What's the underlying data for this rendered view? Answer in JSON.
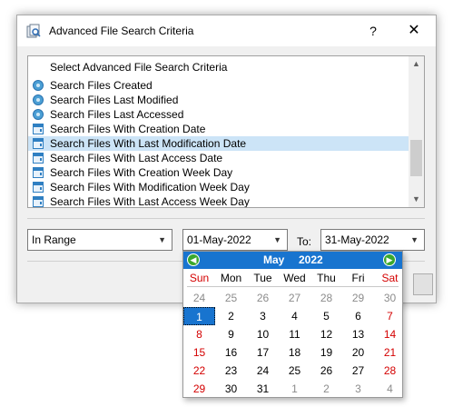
{
  "window": {
    "title": "Advanced File Search Criteria",
    "help_label": "?",
    "close_label": "✕"
  },
  "list": {
    "header": "Select Advanced File Search Criteria",
    "items": [
      {
        "label": "Search Files Created",
        "icon": "clock-icon"
      },
      {
        "label": "Search Files Last Modified",
        "icon": "clock-icon"
      },
      {
        "label": "Search Files Last Accessed",
        "icon": "clock-icon"
      },
      {
        "label": "Search Files With Creation Date",
        "icon": "calendar-icon"
      },
      {
        "label": "Search Files With Last Modification Date",
        "icon": "calendar-icon",
        "selected": true
      },
      {
        "label": "Search Files With Last Access Date",
        "icon": "calendar-icon"
      },
      {
        "label": "Search Files With Creation Week Day",
        "icon": "calendar-icon"
      },
      {
        "label": "Search Files With Modification Week Day",
        "icon": "calendar-icon"
      },
      {
        "label": "Search Files With Last Access Week Day",
        "icon": "calendar-icon"
      }
    ]
  },
  "criteria": {
    "mode": "In Range",
    "from_date": "01-May-2022",
    "to_label": "To:",
    "to_date": "31-May-2022"
  },
  "calendar": {
    "month": "May",
    "year": "2022",
    "prev_label": "◀",
    "next_label": "▶",
    "weekdays": [
      "Sun",
      "Mon",
      "Tue",
      "Wed",
      "Thu",
      "Fri",
      "Sat"
    ],
    "weeks": [
      [
        "24",
        "25",
        "26",
        "27",
        "28",
        "29",
        "30"
      ],
      [
        "1",
        "2",
        "3",
        "4",
        "5",
        "6",
        "7"
      ],
      [
        "8",
        "9",
        "10",
        "11",
        "12",
        "13",
        "14"
      ],
      [
        "15",
        "16",
        "17",
        "18",
        "19",
        "20",
        "21"
      ],
      [
        "22",
        "23",
        "24",
        "25",
        "26",
        "27",
        "28"
      ],
      [
        "29",
        "30",
        "31",
        "1",
        "2",
        "3",
        "4"
      ]
    ],
    "selected_day": "1",
    "colors": {
      "header": "#1874cf",
      "weekend": "#d40000",
      "other_month": "#8c8c8c",
      "nav": "#3aa82e"
    }
  }
}
